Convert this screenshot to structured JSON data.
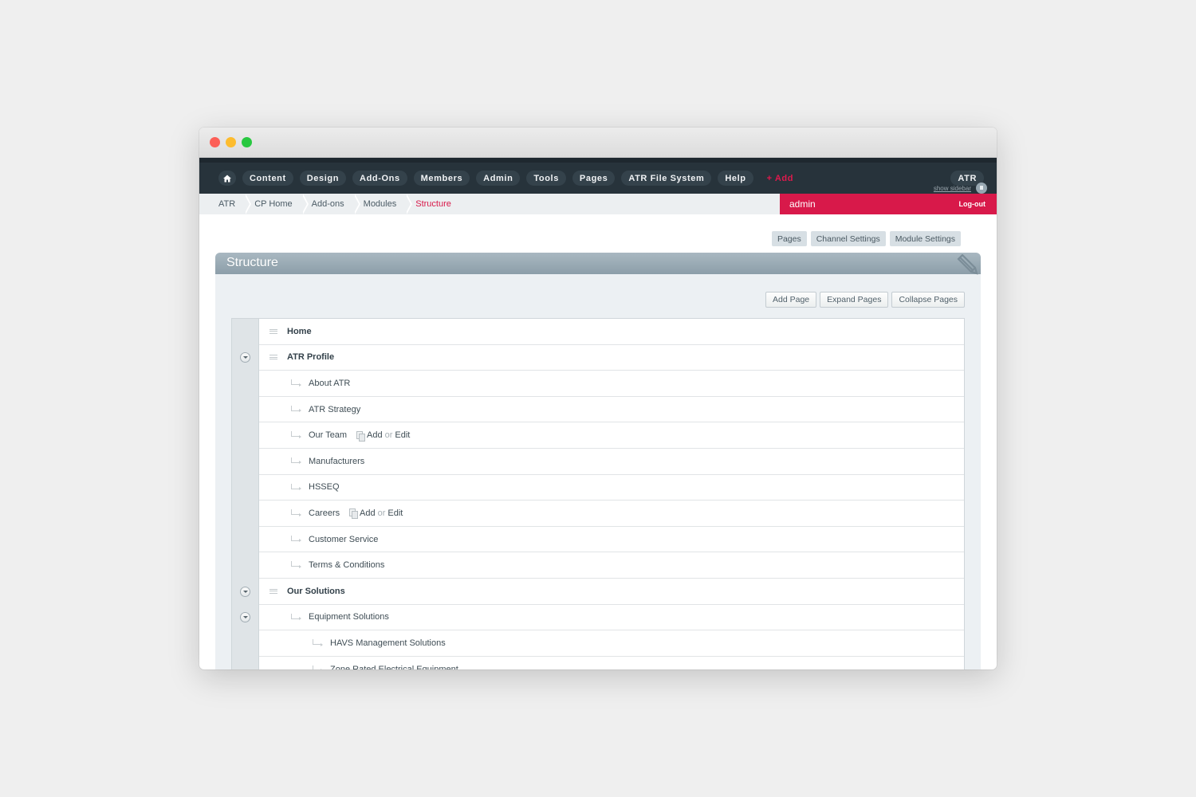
{
  "nav": {
    "home_icon": "home-icon",
    "items": [
      "Content",
      "Design",
      "Add-Ons",
      "Members",
      "Admin",
      "Tools",
      "Pages",
      "ATR File System",
      "Help"
    ],
    "add_label": "+ Add",
    "site_label": "ATR"
  },
  "breadcrumb": [
    "ATR",
    "CP Home",
    "Add-ons",
    "Modules",
    "Structure"
  ],
  "user": {
    "name": "admin",
    "logout_label": "Log-out",
    "accent": "#d8194a"
  },
  "sidebar_toggle": {
    "label": "show sidebar"
  },
  "module_tabs": [
    "Pages",
    "Channel Settings",
    "Module Settings"
  ],
  "panel": {
    "title": "Structure",
    "actions": [
      "Add Page",
      "Expand Pages",
      "Collapse Pages"
    ]
  },
  "tree": [
    {
      "label": "Home",
      "level": 0,
      "toggle": false
    },
    {
      "label": "ATR Profile",
      "level": 0,
      "toggle": true
    },
    {
      "label": "About ATR",
      "level": 1,
      "toggle": false
    },
    {
      "label": "ATR Strategy",
      "level": 1,
      "toggle": false
    },
    {
      "label": "Our Team",
      "level": 1,
      "toggle": false,
      "extra": {
        "add": "Add",
        "or": "or",
        "edit": "Edit"
      }
    },
    {
      "label": "Manufacturers",
      "level": 1,
      "toggle": false
    },
    {
      "label": "HSSEQ",
      "level": 1,
      "toggle": false
    },
    {
      "label": "Careers",
      "level": 1,
      "toggle": false,
      "extra": {
        "add": "Add",
        "or": "or",
        "edit": "Edit"
      }
    },
    {
      "label": "Customer Service",
      "level": 1,
      "toggle": false
    },
    {
      "label": "Terms & Conditions",
      "level": 1,
      "toggle": false
    },
    {
      "label": "Our Solutions",
      "level": 0,
      "toggle": true
    },
    {
      "label": "Equipment Solutions",
      "level": 1,
      "toggle": true
    },
    {
      "label": "HAVS Management Solutions",
      "level": 2,
      "toggle": false
    },
    {
      "label": "Zone Rated Electrical Equipment",
      "level": 2,
      "toggle": false
    }
  ]
}
